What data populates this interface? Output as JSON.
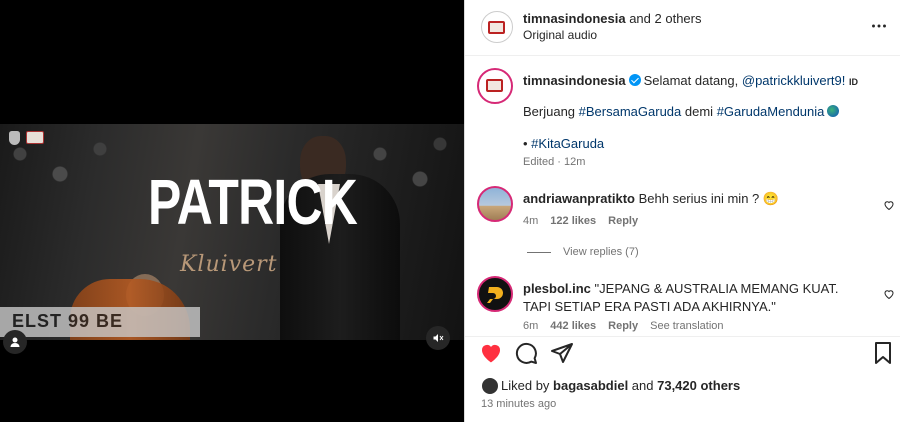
{
  "media": {
    "title_main": "PATRICK",
    "title_script": "Kluivert",
    "banner_text": "ELST 99 BE"
  },
  "header": {
    "username": "timnasindonesia",
    "and_others": "and 2 others",
    "audio": "Original audio"
  },
  "caption": {
    "username": "timnasindonesia",
    "text_prefix": "Selamat datang, ",
    "mention": "@patrickkluivert9!",
    "flag": "ID",
    "line2_prefix": "Berjuang ",
    "hashtag1": "#BersamaGaruda",
    "line2_mid": " demi ",
    "hashtag2": "#GarudaMendunia",
    "line3_prefix": "• ",
    "hashtag3": "#KitaGaruda",
    "edited": "Edited · 12m"
  },
  "comments": [
    {
      "username": "andriawanpratikto",
      "text": "Behh serius ini min ? 😁",
      "time": "4m",
      "likes": "122 likes",
      "reply": "Reply",
      "view_replies": "View replies (7)"
    },
    {
      "username": "plesbol.inc",
      "text": "\"JEPANG & AUSTRALIA MEMANG KUAT. TAPI SETIAP ERA PASTI ADA AKHIRNYA.\"",
      "time": "6m",
      "likes": "442 likes",
      "reply": "Reply",
      "translation": "See translation"
    }
  ],
  "likes": {
    "prefix": "Liked by ",
    "user": "bagasabdiel",
    "mid": " and ",
    "count": "73,420 others"
  },
  "timestamp": "13 minutes ago",
  "colors": {
    "heart_red": "#ff3040",
    "link": "#00376b",
    "muted": "#737373"
  }
}
